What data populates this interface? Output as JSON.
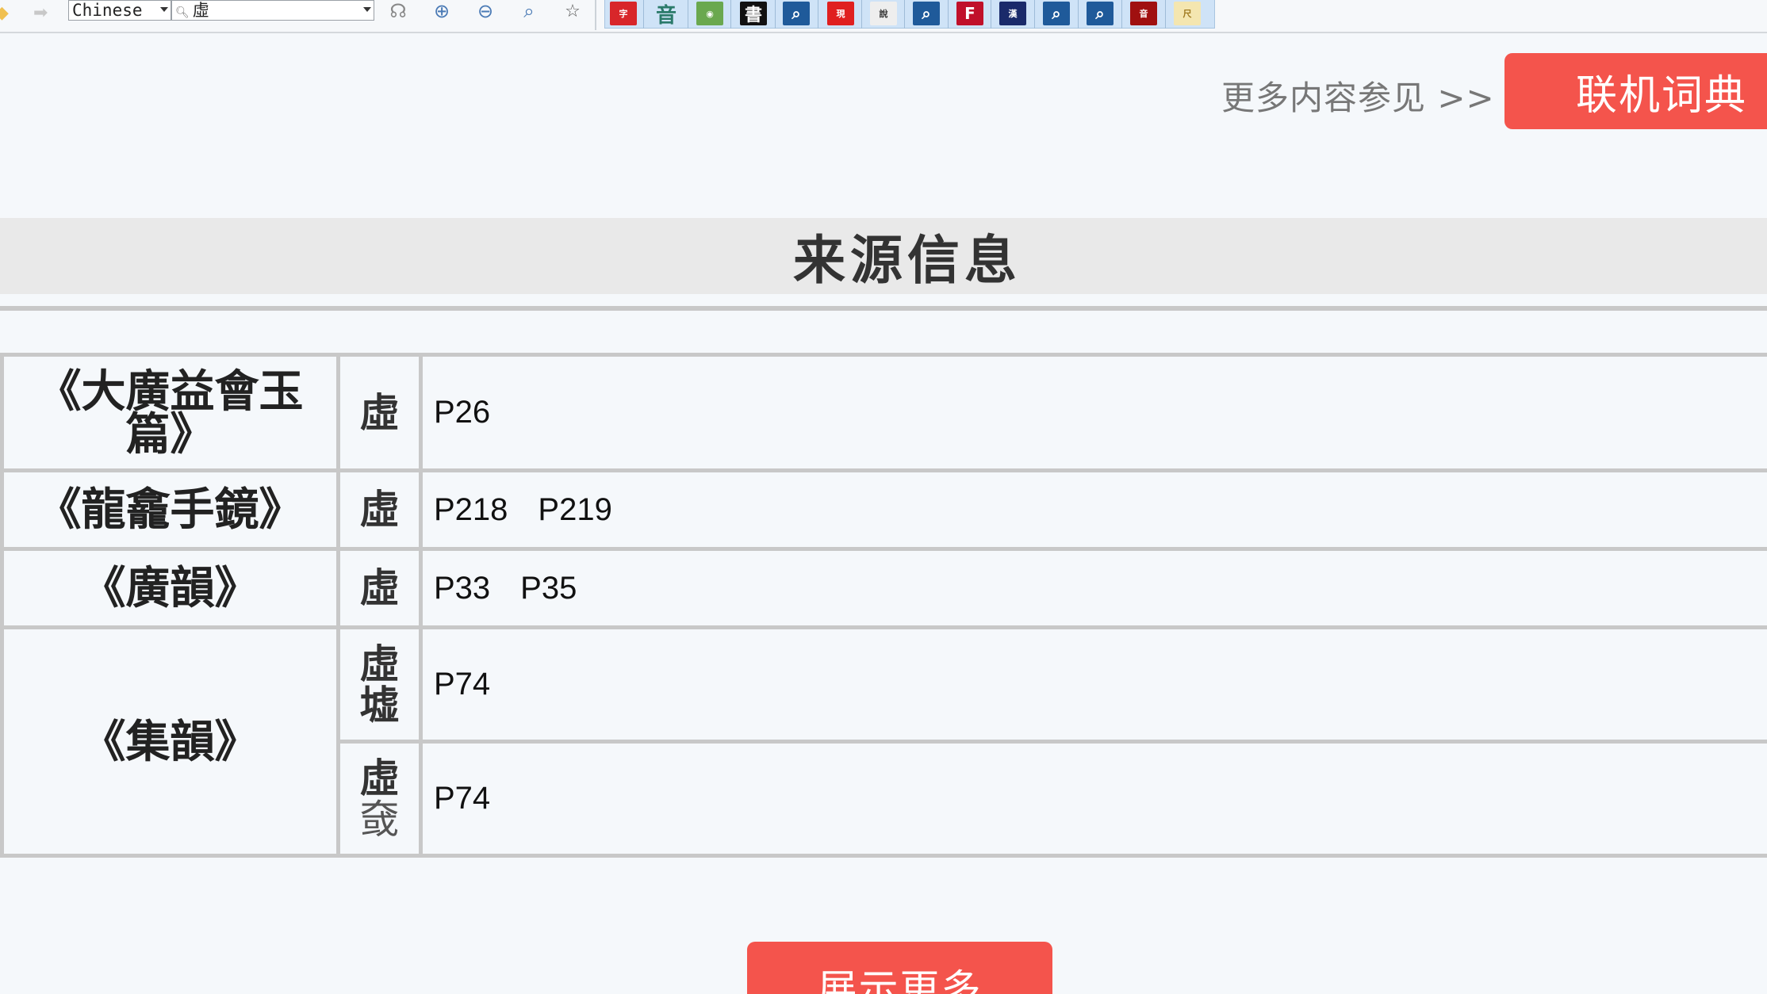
{
  "toolbar": {
    "language": "Chinese",
    "search_value": "虛",
    "dict_tooltips": [
      "新华字典",
      "古音",
      "汉语",
      "书法",
      "搜索1",
      "现代汉语规范词典",
      "说文解字",
      "搜索2",
      "汉字F",
      "新汉英大词典",
      "搜索3",
      "搜索4",
      "音形义字典",
      "尺"
    ]
  },
  "links": {
    "more_text": "更多内容参见 >>",
    "online_dict": "联机词典"
  },
  "section": {
    "title": "来源信息"
  },
  "sources": [
    {
      "book": "《大廣益會玉篇》",
      "entries": [
        {
          "char": "虛",
          "alt": "",
          "pages": [
            "P26"
          ]
        }
      ]
    },
    {
      "book": "《龍龕手鏡》",
      "entries": [
        {
          "char": "虛",
          "alt": "",
          "pages": [
            "P218",
            "P219"
          ]
        }
      ]
    },
    {
      "book": "《廣韻》",
      "entries": [
        {
          "char": "虛",
          "alt": "",
          "pages": [
            "P33",
            "P35"
          ]
        }
      ]
    },
    {
      "book": "《集韻》",
      "entries": [
        {
          "char": "虛",
          "alt": "墟",
          "pages": [
            "P74"
          ]
        },
        {
          "char": "虛",
          "alt": "㚜",
          "pages": [
            "P74"
          ]
        }
      ]
    }
  ],
  "buttons": {
    "show_more": "展示更多"
  },
  "colors": {
    "accent": "#f4544c",
    "header_bg": "#e9e9e9",
    "border": "#c8c8c8",
    "page_bg": "#f5f8fb"
  }
}
